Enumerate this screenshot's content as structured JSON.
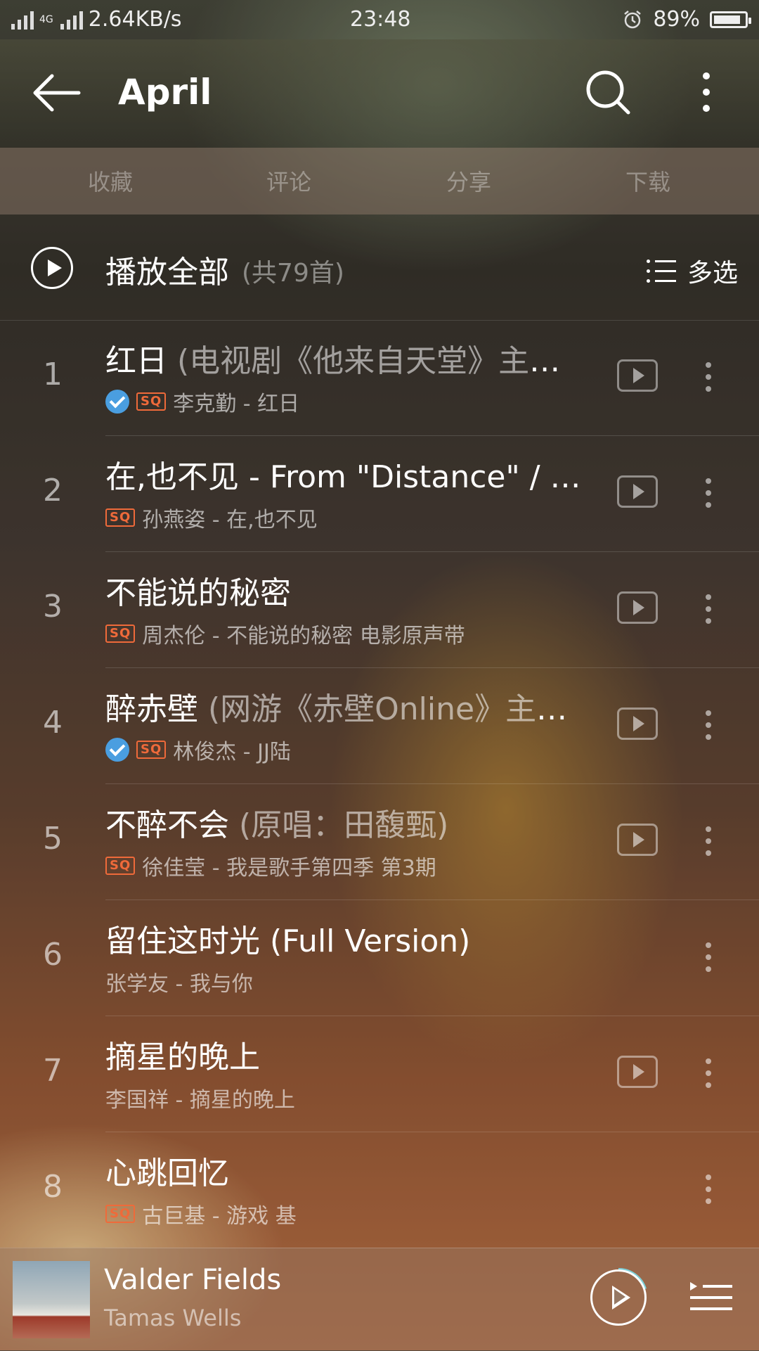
{
  "status": {
    "network_speed": "2.64KB/s",
    "network_type": "4G",
    "time": "23:48",
    "battery": "89%",
    "battery_level": 0.89
  },
  "header": {
    "title": "April"
  },
  "actions": [
    {
      "label": "收藏",
      "icon": "heart-icon"
    },
    {
      "label": "评论",
      "icon": "comment-icon"
    },
    {
      "label": "分享",
      "icon": "share-icon"
    },
    {
      "label": "下载",
      "icon": "download-icon"
    }
  ],
  "play_all": {
    "label": "播放全部",
    "count": "(共79首)",
    "multiselect": "多选"
  },
  "songs": [
    {
      "index": "1",
      "title": "红日",
      "subtitle": "(电视剧《他来自天堂》主题…",
      "downloaded": true,
      "sq": true,
      "meta": "李克勤 - 红日",
      "mv": true
    },
    {
      "index": "2",
      "title": "在,也不见 - From \"Distance\" / Mai…",
      "subtitle": "",
      "downloaded": false,
      "sq": true,
      "meta": "孙燕姿 - 在,也不见",
      "mv": true
    },
    {
      "index": "3",
      "title": "不能说的秘密",
      "subtitle": "",
      "downloaded": false,
      "sq": true,
      "meta": "周杰伦 - 不能说的秘密 电影原声带",
      "mv": true
    },
    {
      "index": "4",
      "title": "醉赤壁",
      "subtitle": "(网游《赤壁Online》主题…",
      "downloaded": true,
      "sq": true,
      "meta": "林俊杰 - JJ陆",
      "mv": true
    },
    {
      "index": "5",
      "title": "不醉不会",
      "subtitle": "(原唱：田馥甄)",
      "downloaded": false,
      "sq": true,
      "meta": "徐佳莹 - 我是歌手第四季 第3期",
      "mv": true
    },
    {
      "index": "6",
      "title": "留住这时光 (Full Version)",
      "subtitle": "",
      "downloaded": false,
      "sq": false,
      "meta": "张学友 - 我与你",
      "mv": false
    },
    {
      "index": "7",
      "title": "摘星的晚上",
      "subtitle": "",
      "downloaded": false,
      "sq": false,
      "meta": "李国祥 - 摘星的晚上",
      "mv": true
    },
    {
      "index": "8",
      "title": "心跳回忆",
      "subtitle": "",
      "downloaded": false,
      "sq": true,
      "meta": "古巨基 - 游戏 基",
      "mv": false
    }
  ],
  "sq_label": "SQ",
  "player": {
    "title": "Valder Fields",
    "artist": "Tamas Wells",
    "progress": 0.2
  }
}
